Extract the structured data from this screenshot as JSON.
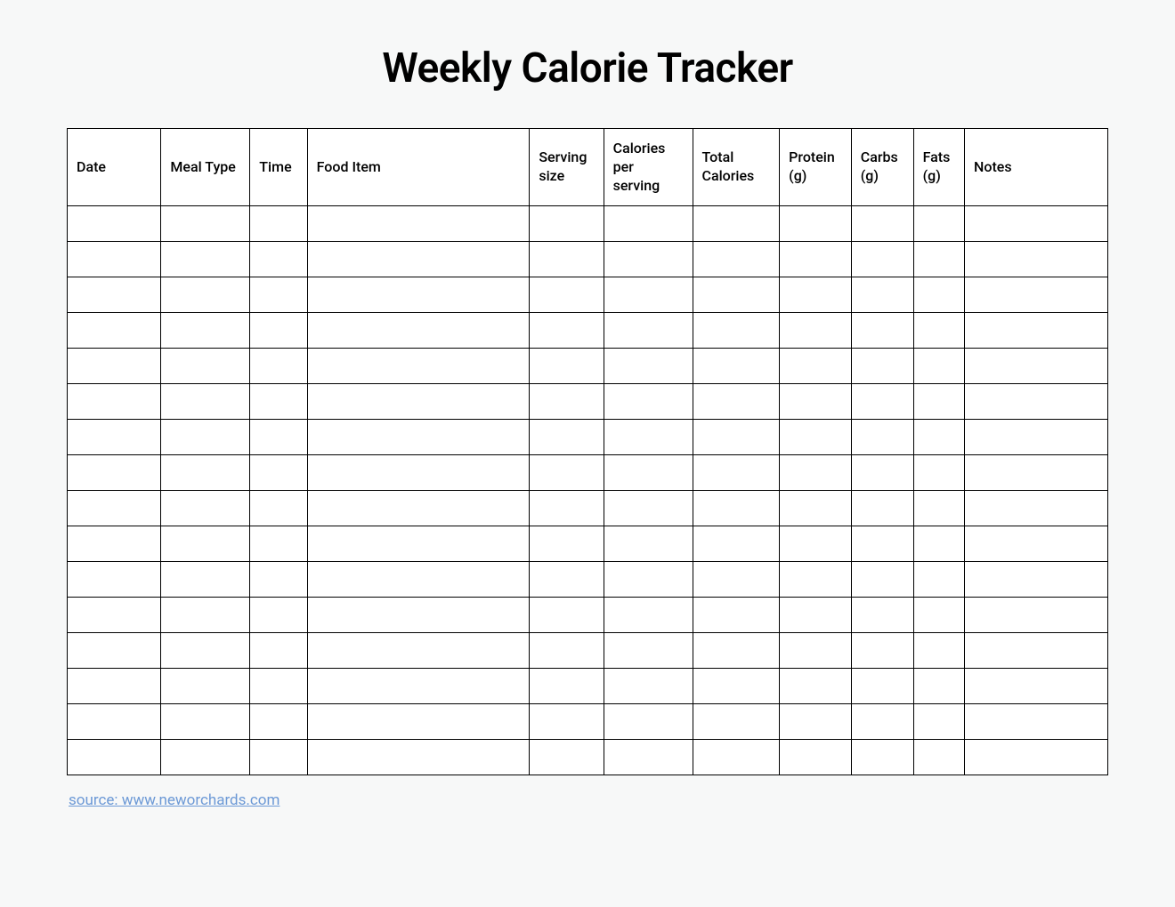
{
  "title": "Weekly Calorie Tracker",
  "columns": {
    "date": "Date",
    "meal_type": "Meal Type",
    "time": "Time",
    "food_item": "Food Item",
    "serving_size": "Serving size",
    "calories_per_serving": "Calories per serving",
    "total_calories": "Total Calories",
    "protein": "Protein (g)",
    "carbs": "Carbs (g)",
    "fats": "Fats (g)",
    "notes": "Notes"
  },
  "rows": [
    {
      "date": "",
      "meal_type": "",
      "time": "",
      "food_item": "",
      "serving_size": "",
      "calories_per_serving": "",
      "total_calories": "",
      "protein": "",
      "carbs": "",
      "fats": "",
      "notes": ""
    },
    {
      "date": "",
      "meal_type": "",
      "time": "",
      "food_item": "",
      "serving_size": "",
      "calories_per_serving": "",
      "total_calories": "",
      "protein": "",
      "carbs": "",
      "fats": "",
      "notes": ""
    },
    {
      "date": "",
      "meal_type": "",
      "time": "",
      "food_item": "",
      "serving_size": "",
      "calories_per_serving": "",
      "total_calories": "",
      "protein": "",
      "carbs": "",
      "fats": "",
      "notes": ""
    },
    {
      "date": "",
      "meal_type": "",
      "time": "",
      "food_item": "",
      "serving_size": "",
      "calories_per_serving": "",
      "total_calories": "",
      "protein": "",
      "carbs": "",
      "fats": "",
      "notes": ""
    },
    {
      "date": "",
      "meal_type": "",
      "time": "",
      "food_item": "",
      "serving_size": "",
      "calories_per_serving": "",
      "total_calories": "",
      "protein": "",
      "carbs": "",
      "fats": "",
      "notes": ""
    },
    {
      "date": "",
      "meal_type": "",
      "time": "",
      "food_item": "",
      "serving_size": "",
      "calories_per_serving": "",
      "total_calories": "",
      "protein": "",
      "carbs": "",
      "fats": "",
      "notes": ""
    },
    {
      "date": "",
      "meal_type": "",
      "time": "",
      "food_item": "",
      "serving_size": "",
      "calories_per_serving": "",
      "total_calories": "",
      "protein": "",
      "carbs": "",
      "fats": "",
      "notes": ""
    },
    {
      "date": "",
      "meal_type": "",
      "time": "",
      "food_item": "",
      "serving_size": "",
      "calories_per_serving": "",
      "total_calories": "",
      "protein": "",
      "carbs": "",
      "fats": "",
      "notes": ""
    },
    {
      "date": "",
      "meal_type": "",
      "time": "",
      "food_item": "",
      "serving_size": "",
      "calories_per_serving": "",
      "total_calories": "",
      "protein": "",
      "carbs": "",
      "fats": "",
      "notes": ""
    },
    {
      "date": "",
      "meal_type": "",
      "time": "",
      "food_item": "",
      "serving_size": "",
      "calories_per_serving": "",
      "total_calories": "",
      "protein": "",
      "carbs": "",
      "fats": "",
      "notes": ""
    },
    {
      "date": "",
      "meal_type": "",
      "time": "",
      "food_item": "",
      "serving_size": "",
      "calories_per_serving": "",
      "total_calories": "",
      "protein": "",
      "carbs": "",
      "fats": "",
      "notes": ""
    },
    {
      "date": "",
      "meal_type": "",
      "time": "",
      "food_item": "",
      "serving_size": "",
      "calories_per_serving": "",
      "total_calories": "",
      "protein": "",
      "carbs": "",
      "fats": "",
      "notes": ""
    },
    {
      "date": "",
      "meal_type": "",
      "time": "",
      "food_item": "",
      "serving_size": "",
      "calories_per_serving": "",
      "total_calories": "",
      "protein": "",
      "carbs": "",
      "fats": "",
      "notes": ""
    },
    {
      "date": "",
      "meal_type": "",
      "time": "",
      "food_item": "",
      "serving_size": "",
      "calories_per_serving": "",
      "total_calories": "",
      "protein": "",
      "carbs": "",
      "fats": "",
      "notes": ""
    },
    {
      "date": "",
      "meal_type": "",
      "time": "",
      "food_item": "",
      "serving_size": "",
      "calories_per_serving": "",
      "total_calories": "",
      "protein": "",
      "carbs": "",
      "fats": "",
      "notes": ""
    },
    {
      "date": "",
      "meal_type": "",
      "time": "",
      "food_item": "",
      "serving_size": "",
      "calories_per_serving": "",
      "total_calories": "",
      "protein": "",
      "carbs": "",
      "fats": "",
      "notes": ""
    }
  ],
  "source_link": "source: www.neworchards.com"
}
